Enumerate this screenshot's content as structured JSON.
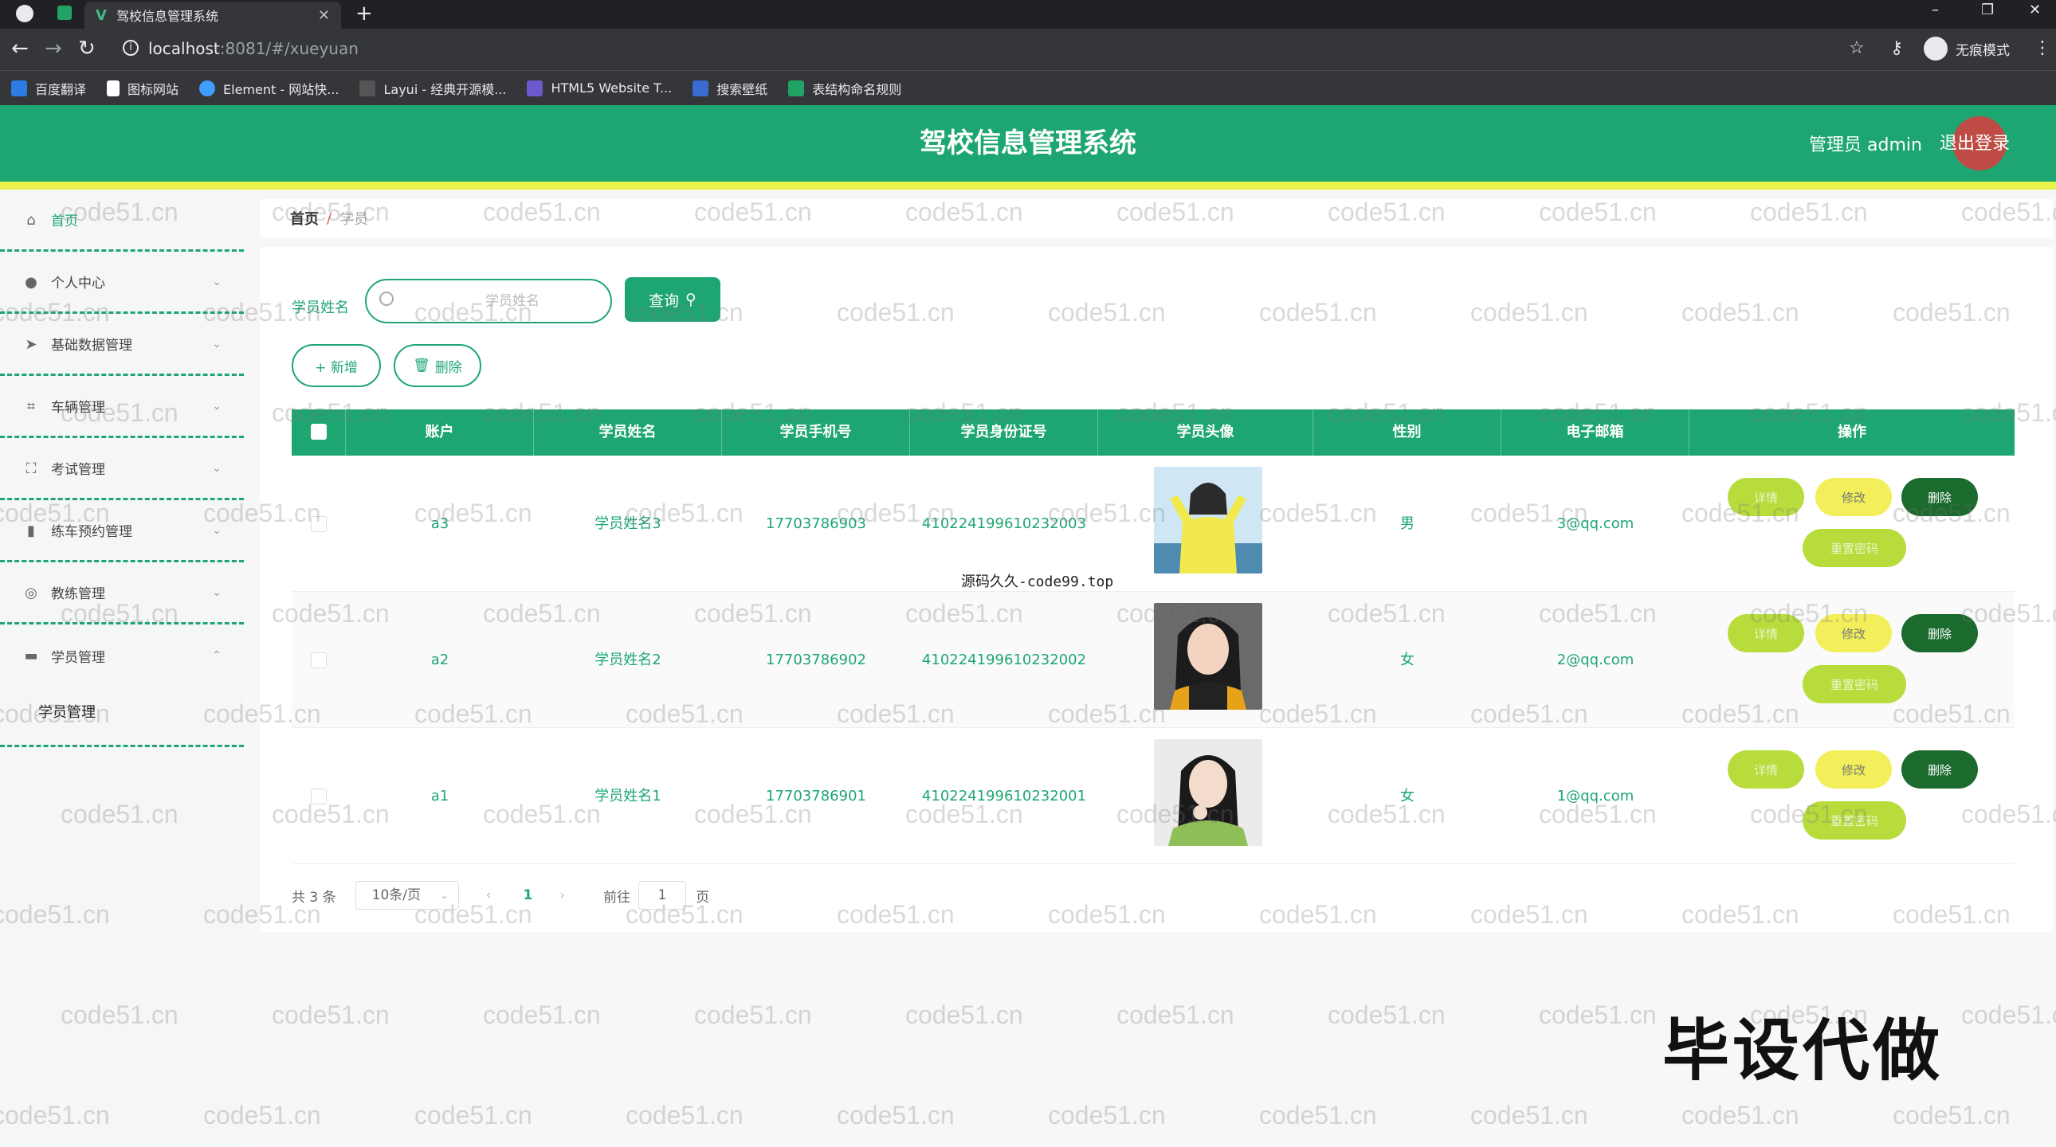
{
  "browser": {
    "tab_title": "驾校信息管理系统",
    "url_host": "localhost",
    "url_path": ":8081/#/xueyuan",
    "profile_label": "无痕模式",
    "bookmarks": [
      "百度翻译",
      "图标网站",
      "Element - 网站快...",
      "Layui - 经典开源模...",
      "HTML5 Website T...",
      "搜索壁纸",
      "表结构命名规则"
    ]
  },
  "header": {
    "title": "驾校信息管理系统",
    "admin_label": "管理员 admin",
    "logout_label": "退出登录"
  },
  "sidebar": {
    "items": [
      {
        "label": "首页",
        "icon": "home-icon"
      },
      {
        "label": "个人中心",
        "icon": "user-icon"
      },
      {
        "label": "基础数据管理",
        "icon": "send-icon"
      },
      {
        "label": "车辆管理",
        "icon": "crop-icon"
      },
      {
        "label": "考试管理",
        "icon": "fullscreen-icon"
      },
      {
        "label": "练车预约管理",
        "icon": "chart-icon"
      },
      {
        "label": "教练管理",
        "icon": "compass-icon"
      },
      {
        "label": "学员管理",
        "icon": "suitcase-icon"
      }
    ],
    "subitem": "学员管理"
  },
  "breadcrumb": {
    "home": "首页",
    "sep": "/",
    "current": "学员"
  },
  "search": {
    "label": "学员姓名",
    "placeholder": "学员姓名",
    "button": "查询"
  },
  "actions": {
    "add": "+ 新增",
    "delete": "删除"
  },
  "table": {
    "columns": [
      "账户",
      "学员姓名",
      "学员手机号",
      "学员身份证号",
      "学员头像",
      "性别",
      "电子邮箱",
      "操作"
    ],
    "rows": [
      {
        "account": "a3",
        "name": "学员姓名3",
        "phone": "17703786903",
        "id_card": "410224199610232003",
        "gender": "男",
        "email": "3@qq.com"
      },
      {
        "account": "a2",
        "name": "学员姓名2",
        "phone": "17703786902",
        "id_card": "410224199610232002",
        "gender": "女",
        "email": "2@qq.com"
      },
      {
        "account": "a1",
        "name": "学员姓名1",
        "phone": "17703786901",
        "id_card": "410224199610232001",
        "gender": "女",
        "email": "1@qq.com"
      }
    ],
    "ops": {
      "detail": "详情",
      "edit": "修改",
      "delete": "删除",
      "reset": "重置密码"
    }
  },
  "pager": {
    "total": "共 3 条",
    "page_size": "10条/页",
    "current_page": "1",
    "goto_label": "前往",
    "goto_value": "1",
    "page_unit": "页"
  },
  "watermarks": {
    "repeat": "code51.cn",
    "center": "源码久久-code99.top",
    "big": "毕设代做"
  },
  "colors": {
    "primary": "#1ea672",
    "accent_yellow": "#e9f24a",
    "danger_dark": "#1b6a2e"
  }
}
